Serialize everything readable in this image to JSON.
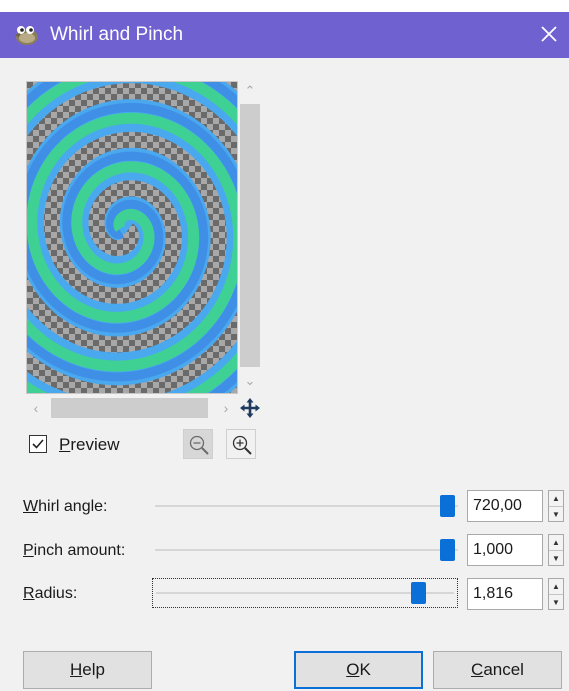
{
  "window": {
    "title": "Whirl and Pinch",
    "title_bar_color": "#6f61d0",
    "icon": "gimp-wilber-icon",
    "close_icon": "close-icon"
  },
  "preview": {
    "checkbox_checked": true,
    "label_mnemonic": "P",
    "label_rest": "review",
    "zoom_out_icon": "zoom-out-icon",
    "zoom_in_icon": "zoom-in-icon",
    "navigate_icon": "move-navigate-icon",
    "colors": {
      "background": "#4aa8ef",
      "green_stripe": "#3fd194",
      "checker_light": "#a8a8a8",
      "checker_dark": "#6a6a6a"
    }
  },
  "params": [
    {
      "mnemonic": "W",
      "label_rest": "hirl angle:",
      "value": "720,00",
      "fraction": 0.965
    },
    {
      "mnemonic": "P",
      "label_rest": "inch amount:",
      "value": "1,000",
      "fraction": 0.965
    },
    {
      "mnemonic": "R",
      "label_rest": "adius:",
      "value": "1,816",
      "fraction": 0.88
    }
  ],
  "buttons": {
    "help": {
      "mnemonic": "H",
      "rest": "elp"
    },
    "ok": {
      "mnemonic": "O",
      "rest": "K"
    },
    "cancel": {
      "mnemonic": "C",
      "rest": "ancel"
    }
  },
  "accent_color": "#0a6fd6"
}
